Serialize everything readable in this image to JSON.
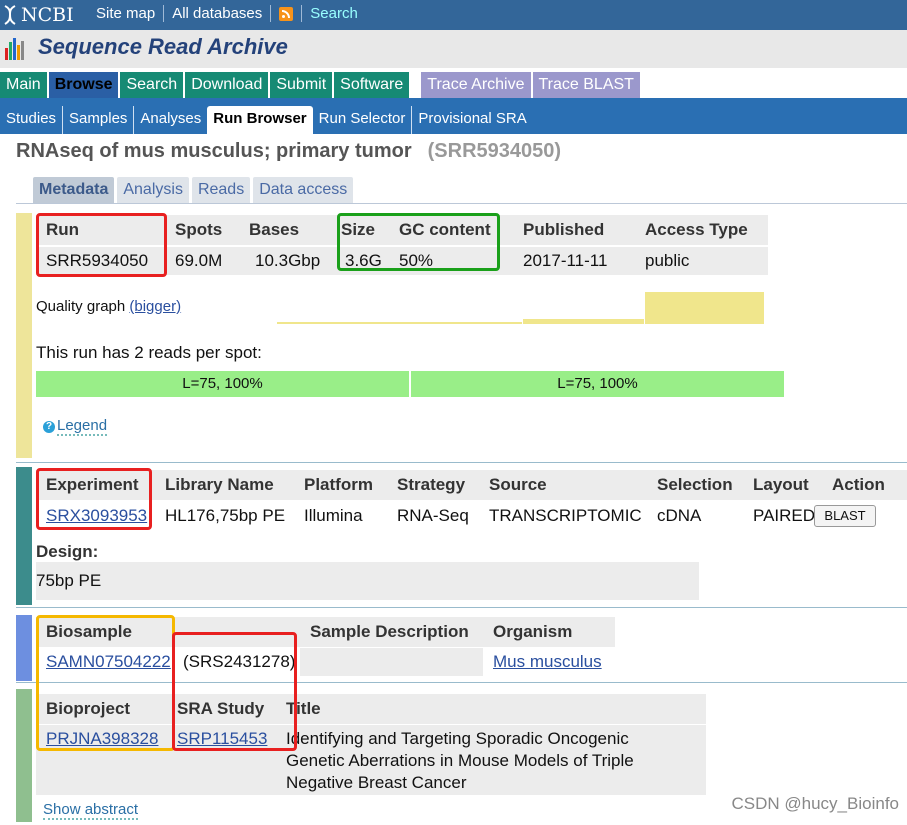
{
  "header": {
    "logo": "NCBI",
    "links": [
      "Site map",
      "All databases",
      "Search"
    ],
    "app_title": "Sequence Read Archive"
  },
  "tabs": [
    "Main",
    "Browse",
    "Search",
    "Download",
    "Submit",
    "Software",
    "Trace Archive",
    "Trace BLAST"
  ],
  "subnav": [
    "Studies",
    "Samples",
    "Analyses",
    "Run Browser",
    "Run Selector",
    "Provisional SRA"
  ],
  "page": {
    "title": "RNAseq of mus musculus; primary tumor",
    "accession": "(SRR5934050)"
  },
  "section_tabs": [
    "Metadata",
    "Analysis",
    "Reads",
    "Data access"
  ],
  "run": {
    "headers": [
      "Run",
      "Spots",
      "Bases",
      "Size",
      "GC content",
      "Published",
      "Access Type"
    ],
    "values": [
      "SRR5934050",
      "69.0M",
      "10.3Gbp",
      "3.6G",
      "50%",
      "2017-11-11",
      "public"
    ],
    "quality_graph": "Quality graph",
    "bigger": "(bigger)",
    "reads_text": "This run has 2 reads per spot:",
    "reads": [
      "L=75, 100%",
      "L=75, 100%"
    ],
    "legend": "Legend"
  },
  "experiment": {
    "headers": [
      "Experiment",
      "Library Name",
      "Platform",
      "Strategy",
      "Source",
      "Selection",
      "Layout",
      "Action"
    ],
    "values": [
      "SRX3093953",
      "HL176,75bp PE",
      "Illumina",
      "RNA-Seq",
      "TRANSCRIPTOMIC",
      "cDNA",
      "PAIRED"
    ],
    "action": "BLAST",
    "design_label": "Design:",
    "design_value": "75bp PE"
  },
  "biosample": {
    "headers": [
      "Biosample",
      "",
      "Sample Description",
      "Organism"
    ],
    "id": "SAMN07504222",
    "srs": "(SRS2431278)",
    "organism": "Mus musculus"
  },
  "bioproject": {
    "headers": [
      "Bioproject",
      "SRA Study",
      "Title"
    ],
    "id": "PRJNA398328",
    "study": "SRP115453",
    "title_lines": [
      "Identifying and Targeting Sporadic Oncogenic",
      "Genetic Aberrations in Mouse Models of Triple",
      "Negative Breast Cancer"
    ],
    "show_abstract": "Show abstract"
  },
  "watermark": "CSDN @hucy_Bioinfo",
  "colors": {
    "ncbi_blue": "#336699",
    "tab_green": "#168a74",
    "trace_purple": "#9b98cc",
    "read_green": "#99ee88",
    "quality_yellow": "#f0e68c"
  }
}
